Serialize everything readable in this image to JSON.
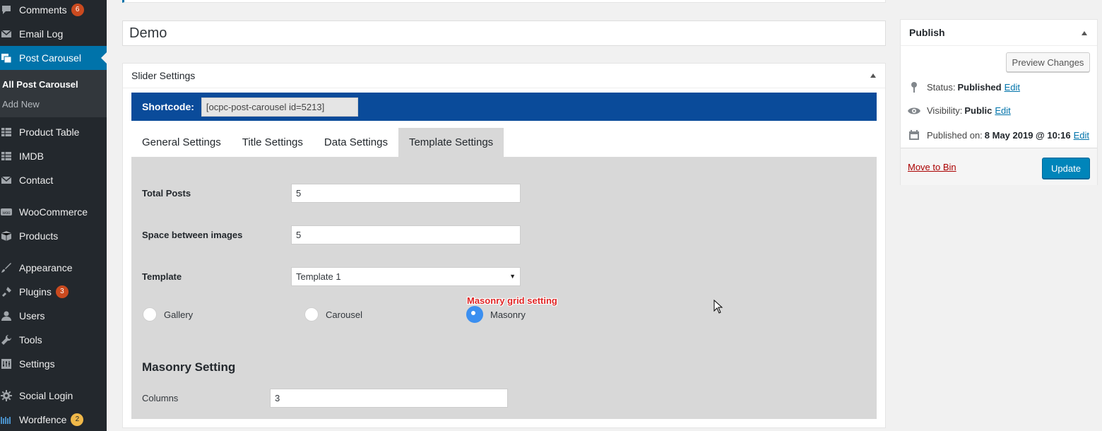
{
  "sidebar": {
    "items": [
      {
        "label": "Comments",
        "icon": "comment-icon",
        "badge": "6"
      },
      {
        "label": "Email Log",
        "icon": "envelope-icon"
      },
      {
        "label": "Post Carousel",
        "icon": "images-icon",
        "active": true
      },
      {
        "label": "Product Table",
        "icon": "table-icon"
      },
      {
        "label": "IMDB",
        "icon": "table-icon"
      },
      {
        "label": "Contact",
        "icon": "envelope-icon"
      },
      {
        "label": "WooCommerce",
        "icon": "woo-icon"
      },
      {
        "label": "Products",
        "icon": "box-icon"
      },
      {
        "label": "Appearance",
        "icon": "brush-icon"
      },
      {
        "label": "Plugins",
        "icon": "plug-icon",
        "badge": "3"
      },
      {
        "label": "Users",
        "icon": "user-icon"
      },
      {
        "label": "Tools",
        "icon": "wrench-icon"
      },
      {
        "label": "Settings",
        "icon": "settings-icon"
      },
      {
        "label": "Social Login",
        "icon": "gear-icon"
      },
      {
        "label": "Wordfence",
        "icon": "wordfence-icon",
        "badge": "2"
      }
    ],
    "submenu": [
      {
        "label": "All Post Carousel",
        "current": true
      },
      {
        "label": "Add New"
      }
    ]
  },
  "post_title": "Demo",
  "slider_settings": {
    "title": "Slider Settings",
    "shortcode_label": "Shortcode:",
    "shortcode_value": "[ocpc-post-carousel id=5213]",
    "tabs": [
      "General Settings",
      "Title Settings",
      "Data Settings",
      "Template Settings"
    ],
    "active_tab": "Template Settings",
    "fields": {
      "total_posts_label": "Total Posts",
      "total_posts_value": "5",
      "space_label": "Space between images",
      "space_value": "5",
      "template_label": "Template",
      "template_value": "Template 1"
    },
    "layout_options": [
      {
        "label": "Gallery",
        "checked": false
      },
      {
        "label": "Carousel",
        "checked": false
      },
      {
        "label": "Masonry",
        "checked": true
      }
    ],
    "annotation": "Masonry grid setting",
    "masonry_heading": "Masonry Setting",
    "columns_label": "Columns",
    "columns_value": "3"
  },
  "publish": {
    "title": "Publish",
    "preview_label": "Preview Changes",
    "status_label": "Status:",
    "status_value": "Published",
    "visibility_label": "Visibility:",
    "visibility_value": "Public",
    "published_label": "Published on:",
    "published_value": "8 May 2019 @ 10:16",
    "edit_label": "Edit",
    "move_to_bin": "Move to Bin",
    "update_label": "Update"
  },
  "colors": {
    "sidebar_bg": "#23282d",
    "active_menu": "#0073aa",
    "shortcode_bar": "#0a4b9a",
    "update_button": "#0085ba",
    "annotation": "#e02424",
    "radio_checked": "#3b8ff0"
  }
}
